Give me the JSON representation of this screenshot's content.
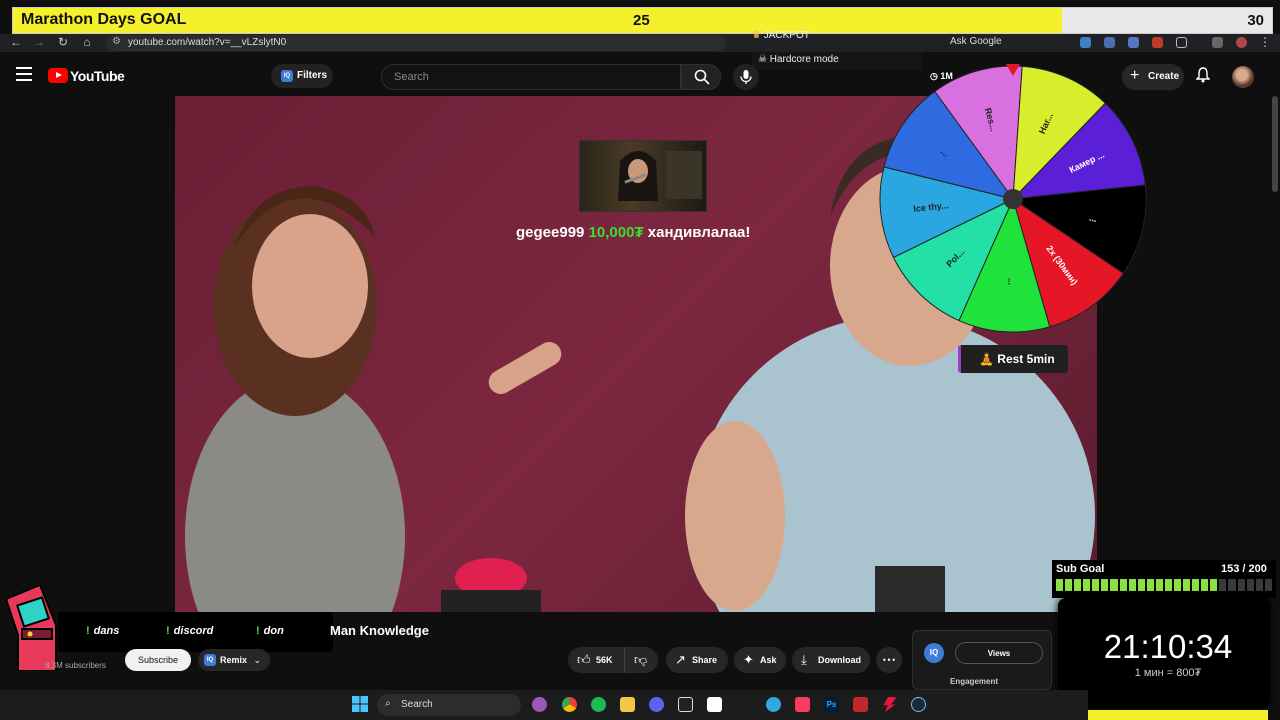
{
  "goal": {
    "title": "Marathon Days GOAL",
    "current": "25",
    "max": "30",
    "fraction": 0.8333
  },
  "browser": {
    "url": "youtube.com/watch?v=__vLZslytN0",
    "ask_google": "Ask Google"
  },
  "overlays": {
    "jackpot": "JACKPOT",
    "hardcore": "Hardcore mode",
    "rest": "Rest 5min"
  },
  "header": {
    "logo_text": "YouTube",
    "filters": "Filters",
    "search_placeholder": "Search",
    "create": "Create",
    "views_badge": "1M"
  },
  "donation": {
    "user": "gegee999",
    "amount": "10,000₮",
    "message": "хандивлалаа!"
  },
  "wheel": {
    "segments": [
      {
        "label": "Res...",
        "color": "#d970e0"
      },
      {
        "label": "Har...",
        "color": "#d8ee2c"
      },
      {
        "label": "Камер ...",
        "color": "#5a1fd6"
      },
      {
        "label": "...",
        "color": "#000000"
      },
      {
        "label": "2x (30мин)",
        "color": "#e51726"
      },
      {
        "label": "...",
        "color": "#1fe23a"
      },
      {
        "label": "Pol...",
        "color": "#22e0a6"
      },
      {
        "label": "Ice thy...",
        "color": "#2aa7e0"
      },
      {
        "label": "...",
        "color": "#2f6be0"
      }
    ]
  },
  "video": {
    "title": "Man Knowledge",
    "subscribers": "8.3M subscribers",
    "subscribe": "Subscribe",
    "remix": "Remix",
    "likes": "56K",
    "share": "Share",
    "ask": "Ask",
    "download": "Download"
  },
  "analytics": {
    "views_tab": "Views",
    "engagement": "Engagement"
  },
  "commands": [
    "dans",
    "discord",
    "don"
  ],
  "sub_goal": {
    "label": "Sub Goal",
    "count": "153 / 200",
    "fraction": 0.765
  },
  "timer": {
    "time": "21:10:34",
    "rate": "1 мин = 800₮"
  },
  "taskbar": {
    "search": "Search"
  }
}
